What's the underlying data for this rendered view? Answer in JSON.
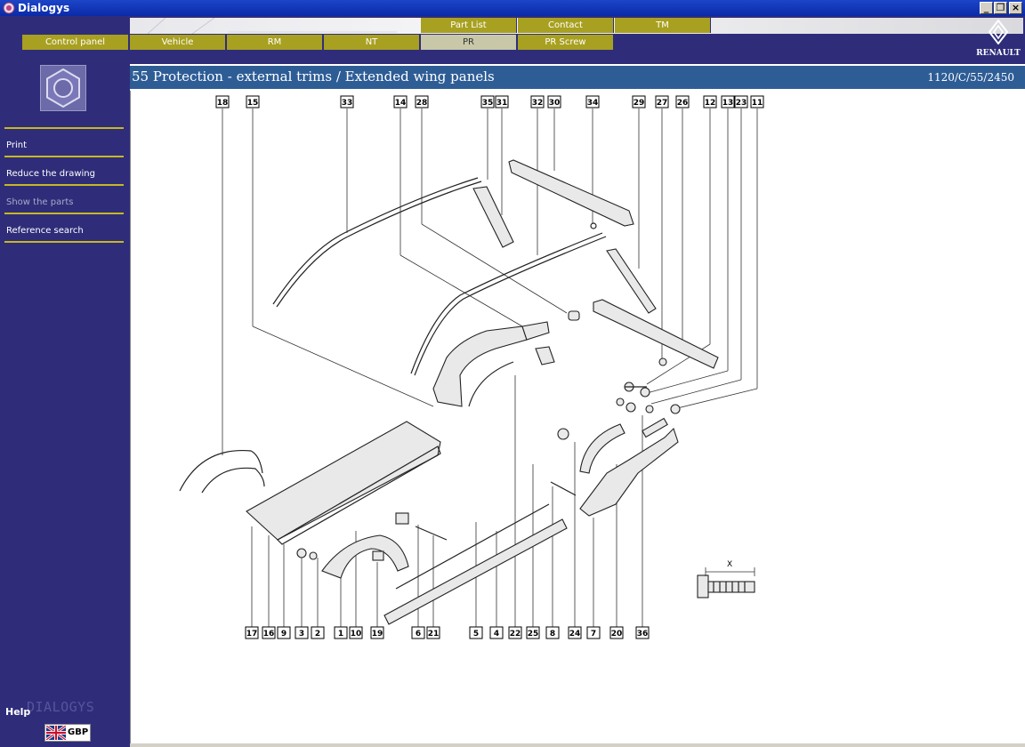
{
  "window": {
    "title": "Dialogys"
  },
  "top_tabs": [
    {
      "label": "Part List"
    },
    {
      "label": "Contact"
    },
    {
      "label": "TM"
    }
  ],
  "nav_tabs": [
    {
      "label": "Control panel"
    },
    {
      "label": "Vehicle"
    },
    {
      "label": "RM"
    },
    {
      "label": "NT"
    },
    {
      "label": "PR",
      "active": true
    },
    {
      "label": "PR Screw"
    }
  ],
  "brand": {
    "name": "RENAULT"
  },
  "sidebar": {
    "items": [
      {
        "label": "Print",
        "enabled": true
      },
      {
        "label": "Reduce the drawing",
        "enabled": true
      },
      {
        "label": "Show the parts",
        "enabled": false
      },
      {
        "label": "Reference search",
        "enabled": true
      }
    ],
    "help": "Help",
    "watermark": "DIALOGYS",
    "language": "GBP"
  },
  "main": {
    "title": "55 Protection - external trims / Extended wing panels",
    "ref_code": "1120/C/55/2450"
  },
  "drawing": {
    "top_labels": [
      "18",
      "15",
      "33",
      "14",
      "28",
      "35",
      "31",
      "32",
      "30",
      "34",
      "29",
      "27",
      "26",
      "12",
      "13",
      "23",
      "11"
    ],
    "bottom_labels": [
      "17",
      "16",
      "9",
      "3",
      "2",
      "1",
      "10",
      "19",
      "6",
      "21",
      "5",
      "4",
      "22",
      "25",
      "8",
      "24",
      "7",
      "20",
      "36"
    ],
    "dimension_label": "X"
  },
  "colors": {
    "sidebar_bg": "#2f2d7a",
    "tab_bg": "#a8a020",
    "tab_active_bg": "#c8c8a8",
    "title_bar_bg": "#2e5d96",
    "separator": "#c8b820"
  }
}
